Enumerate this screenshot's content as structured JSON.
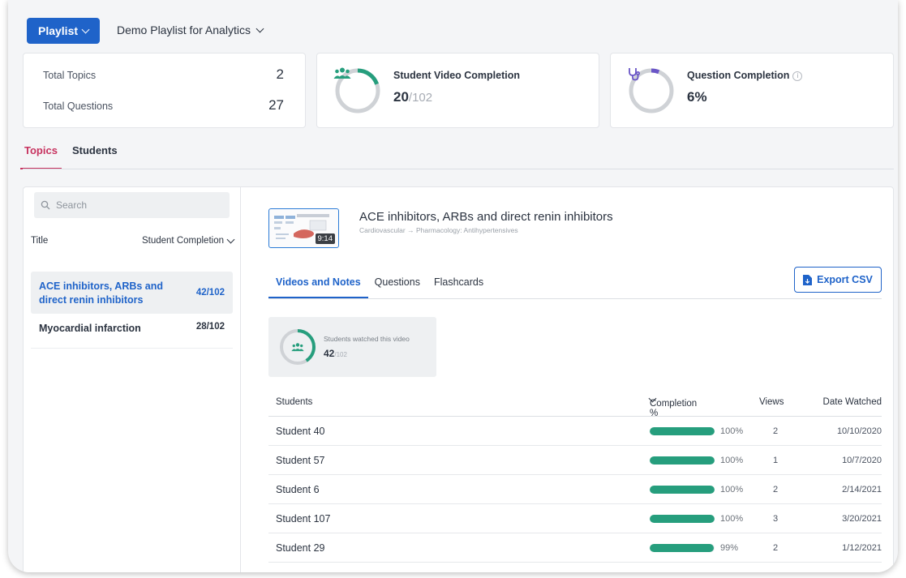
{
  "header": {
    "playlist_button": "Playlist",
    "playlist_name": "Demo Playlist for Analytics"
  },
  "stats": {
    "total_topics_label": "Total Topics",
    "total_topics_value": "2",
    "total_questions_label": "Total Questions",
    "total_questions_value": "27",
    "video_completion": {
      "title": "Student Video Completion",
      "value": "20",
      "total": "/102",
      "fraction": 0.196,
      "icon": "users-icon",
      "color": "#269e7d"
    },
    "question_completion": {
      "title": "Question Completion",
      "info_icon": "i",
      "value": "6%",
      "fraction": 0.06,
      "icon": "stethoscope-icon",
      "color": "#6a55c7"
    }
  },
  "main_tabs": [
    "Topics",
    "Students"
  ],
  "left_panel": {
    "search_placeholder": "Search",
    "col_title": "Title",
    "col_completion": "Student Completion",
    "topics": [
      {
        "title": "ACE inhibitors, ARBs and direct renin inhibitors",
        "count": "42/102",
        "selected": true
      },
      {
        "title": "Myocardial infarction",
        "count": "28/102",
        "selected": false
      }
    ]
  },
  "video": {
    "title": "ACE inhibitors, ARBs and direct renin inhibitors",
    "crumb_1": "Cardiovascular",
    "crumb_arrow": "→",
    "crumb_2": "Pharmacology: Antihypertensives",
    "duration": "9:14"
  },
  "sub_tabs": [
    "Videos and Notes",
    "Questions",
    "Flashcards"
  ],
  "export_label": "Export CSV",
  "watched": {
    "label": "Students watched this video",
    "value": "42",
    "total": "/102",
    "fraction": 0.41
  },
  "table": {
    "headers": {
      "students": "Students",
      "completion": "Completion %",
      "views": "Views",
      "date": "Date Watched"
    },
    "rows": [
      {
        "student": "Student 40",
        "completion": 100,
        "completion_label": "100%",
        "views": "2",
        "date": "10/10/2020"
      },
      {
        "student": "Student 57",
        "completion": 100,
        "completion_label": "100%",
        "views": "1",
        "date": "10/7/2020"
      },
      {
        "student": "Student 6",
        "completion": 100,
        "completion_label": "100%",
        "views": "2",
        "date": "2/14/2021"
      },
      {
        "student": "Student 107",
        "completion": 100,
        "completion_label": "100%",
        "views": "3",
        "date": "3/20/2021"
      },
      {
        "student": "Student 29",
        "completion": 99,
        "completion_label": "99%",
        "views": "2",
        "date": "1/12/2021"
      }
    ]
  }
}
